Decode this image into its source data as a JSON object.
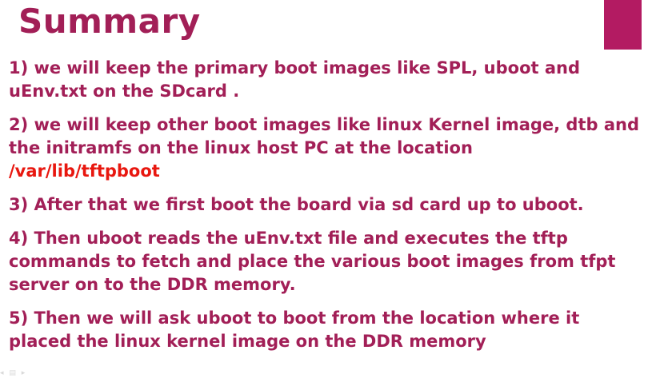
{
  "slide": {
    "title": "Summary",
    "items": [
      {
        "text": "1) we will keep the primary boot images like SPL, uboot and uEnv.txt on the SDcard ."
      },
      {
        "text": "2) we will keep other boot images like linux Kernel image, dtb and the initramfs on the linux host PC at the location",
        "path": "/var/lib/tftpboot"
      },
      {
        "text": "3) After that we first boot the board via sd card up to uboot."
      },
      {
        "text": "4) Then uboot reads the uEnv.txt file and executes the tftp commands to fetch and place the various boot images from tfpt server on to the DDR memory."
      },
      {
        "text": "5) Then we will ask uboot to boot from the location where it placed the linux kernel image on the DDR memory"
      }
    ]
  },
  "colors": {
    "title": "#a21f57",
    "accent": "#b31b62",
    "body_text": "#a21f57",
    "path_highlight": "#e8170f"
  },
  "icons": {
    "corner_controls": "slide-controls-icon"
  }
}
